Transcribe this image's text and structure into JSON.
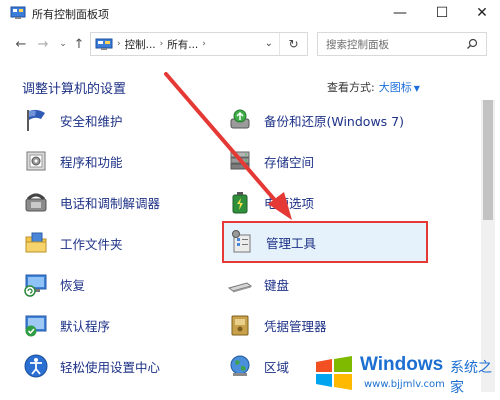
{
  "window": {
    "title": "所有控制面板项",
    "minimize_glyph": "—",
    "maximize_glyph": "☐",
    "close_glyph": "✕"
  },
  "nav": {
    "back_glyph": "←",
    "forward_glyph": "→",
    "dropdown_glyph": "⌄",
    "up_glyph": "↑",
    "breadcrumb": [
      "控制...",
      "所有..."
    ],
    "breadcrumb_sep": "›",
    "address_dropdown_glyph": "⌄",
    "refresh_glyph": "↻",
    "search_placeholder": "搜索控制面板"
  },
  "content": {
    "heading": "调整计算机的设置",
    "view_by_label": "查看方式:",
    "view_by_value": "大图标",
    "view_by_caret": "▼"
  },
  "items_left": [
    {
      "label": "安全和维护",
      "icon": "flag-icon"
    },
    {
      "label": "程序和功能",
      "icon": "programs-icon"
    },
    {
      "label": "电话和调制解调器",
      "icon": "phone-modem-icon"
    },
    {
      "label": "工作文件夹",
      "icon": "work-folders-icon"
    },
    {
      "label": "恢复",
      "icon": "recovery-icon"
    },
    {
      "label": "默认程序",
      "icon": "default-programs-icon"
    },
    {
      "label": "轻松使用设置中心",
      "icon": "ease-of-access-icon"
    }
  ],
  "items_right": [
    {
      "label": "备份和还原(Windows 7)",
      "icon": "backup-icon"
    },
    {
      "label": "存储空间",
      "icon": "storage-icon"
    },
    {
      "label": "电源选项",
      "icon": "power-icon"
    },
    {
      "label": "管理工具",
      "icon": "admin-tools-icon"
    },
    {
      "label": "键盘",
      "icon": "keyboard-icon"
    },
    {
      "label": "凭据管理器",
      "icon": "credential-icon"
    },
    {
      "label": "区域",
      "icon": "region-icon"
    }
  ],
  "watermark": {
    "brand": "Windows",
    "brand_cn": "系统之家",
    "url": "www.bjjmlv.com"
  },
  "colors": {
    "link_blue": "#1e3287",
    "accent_blue": "#1e6fd9",
    "highlight_bg": "#e5f1fb",
    "annotation_red": "#e53935"
  }
}
